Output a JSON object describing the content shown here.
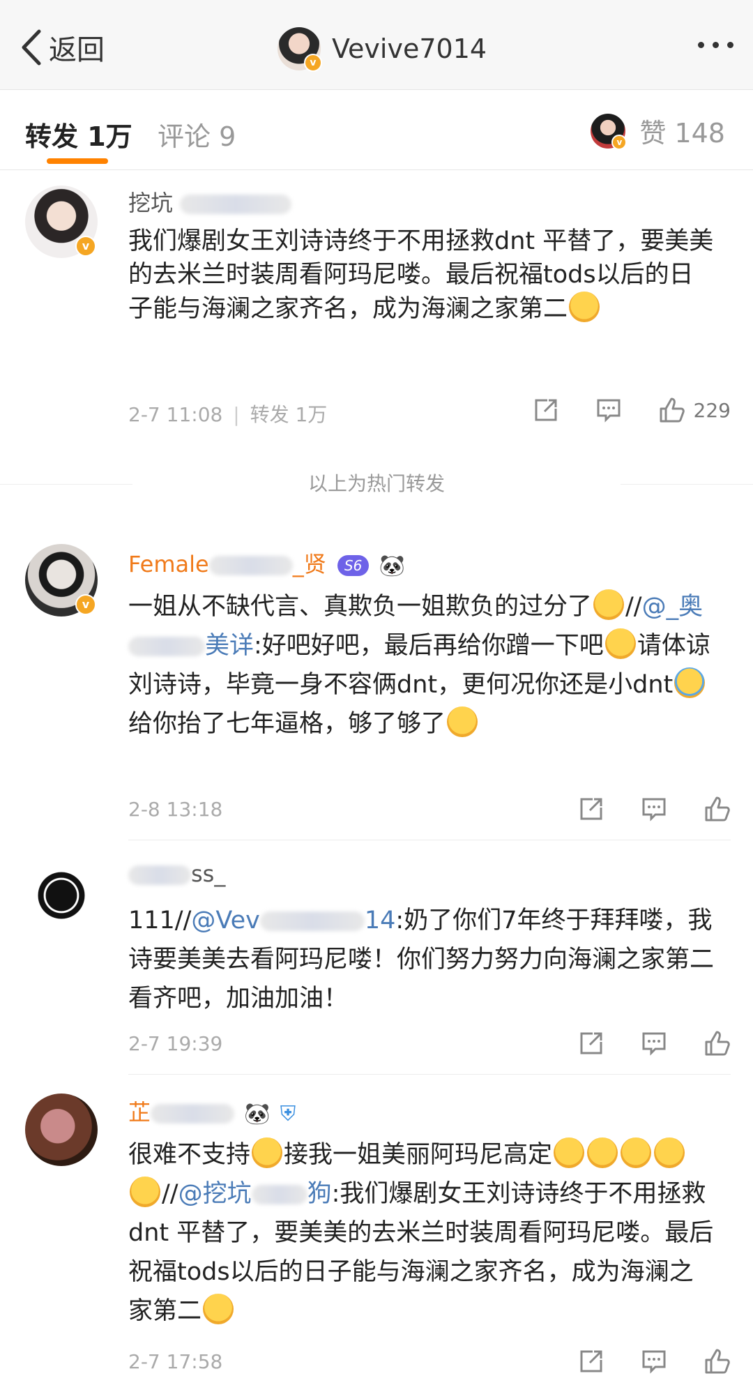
{
  "nav": {
    "back_label": "返回",
    "title": "Vevive7014"
  },
  "tabs": {
    "forward_label": "转发 1万",
    "comment_label": "评论 9",
    "likes_label": "赞 148",
    "accent_color": "#ff8200"
  },
  "hot_separator": "以上为热门转发",
  "comments": [
    {
      "name_visible": "挖坑",
      "body": "我们爆剧女王刘诗诗终于不用拯救dnt 平替了，要美美的去米兰时装周看阿玛尼喽。最后祝福tods以后的日子能与海澜之家齐名，成为海澜之家第二",
      "time": "2-7 11:08",
      "forward": "转发 1万",
      "likes": "229"
    },
    {
      "name_visible": "Female",
      "name_suffix": "_贤",
      "level_badge": "S6",
      "body_part1": "一姐从不缺代言、真欺负一姐欺负的过分了",
      "mention": "@_奥",
      "mention_suffix": "美详",
      "body_part2": ":好吧好吧，最后再给你蹭一下吧",
      "body_part3": "请体谅刘诗诗，毕竟一身不容俩dnt，更何况你还是小dnt",
      "body_part4": "给你抬了七年逼格，够了够了",
      "time": "2-8 13:18"
    },
    {
      "name_visible": "ss_",
      "prefix": "111//",
      "mention": "@Vev",
      "mention_suffix": "14",
      "body": ":奶了你们7年终于拜拜喽，我诗要美美去看阿玛尼喽！你们努力努力向海澜之家第二看齐吧，加油加油！",
      "time": "2-7 19:39"
    },
    {
      "name_visible": "芷",
      "body_part1": "很难不支持",
      "body_part2": "接我一姐美丽阿玛尼高定",
      "mention": "@挖坑",
      "mention_suffix": "狗",
      "body_part3": ":我们爆剧女王刘诗诗终于不用拯救dnt 平替了，要美美的去米兰时装周看阿玛尼喽。最后祝福tods以后的日子能与海澜之家齐名，成为海澜之家第二",
      "time": "2-7 17:58"
    }
  ]
}
